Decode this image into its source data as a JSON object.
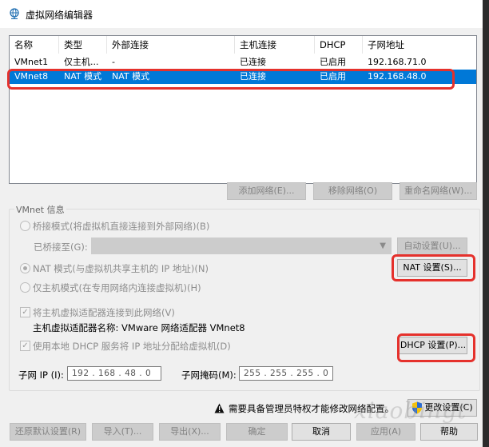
{
  "window": {
    "title": "虚拟网络编辑器"
  },
  "table": {
    "headers": [
      "名称",
      "类型",
      "外部连接",
      "主机连接",
      "DHCP",
      "子网地址"
    ],
    "rows": [
      {
        "name": "VMnet1",
        "type": "仅主机...",
        "external": "-",
        "host": "已连接",
        "dhcp": "已启用",
        "subnet": "192.168.71.0"
      },
      {
        "name": "VMnet8",
        "type": "NAT 模式",
        "external": "NAT 模式",
        "host": "已连接",
        "dhcp": "已启用",
        "subnet": "192.168.48.0",
        "selected": true
      }
    ]
  },
  "list_buttons": {
    "add": "添加网络(E)...",
    "remove": "移除网络(O)",
    "rename": "重命名网络(W)..."
  },
  "vmnet_info": {
    "group_label": "VMnet 信息",
    "bridge_mode": "桥接模式(将虚拟机直接连接到外部网络)(B)",
    "bridged_to_label": "已桥接至(G):",
    "bridged_to_value": "",
    "auto_settings": "自动设置(U)...",
    "nat_mode": "NAT 模式(与虚拟机共享主机的 IP 地址)(N)",
    "nat_settings": "NAT 设置(S)...",
    "host_only_mode": "仅主机模式(在专用网络内连接虚拟机)(H)",
    "connect_adapter": "将主机虚拟适配器连接到此网络(V)",
    "adapter_name": "主机虚拟适配器名称: VMware 网络适配器 VMnet8",
    "use_dhcp": "使用本地 DHCP 服务将 IP 地址分配给虚拟机(D)",
    "dhcp_settings": "DHCP 设置(P)...",
    "subnet_ip_label": "子网 IP (I):",
    "subnet_ip": "192 . 168 . 48 . 0",
    "subnet_mask_label": "子网掩码(M):",
    "subnet_mask": "255 . 255 . 255 . 0",
    "selected_mode": "nat",
    "connect_adapter_checked": true,
    "use_dhcp_checked": true
  },
  "admin": {
    "notice": "需要具备管理员特权才能修改网络配置。",
    "change_settings": "更改设置(C)"
  },
  "footer": {
    "restore": "还原默认设置(R)",
    "import": "导入(T)...",
    "export": "导出(X)...",
    "ok": "确定",
    "cancel": "取消",
    "apply": "应用(A)",
    "help": "帮助"
  },
  "watermark": "xiaobingt",
  "icons": {
    "title": "network-globe-icon",
    "warning": "warning-icon",
    "shield": "uac-shield-icon"
  },
  "colors": {
    "selection": "#0078d7",
    "highlight": "#e5312c",
    "dialog": "#f0f0f0"
  }
}
